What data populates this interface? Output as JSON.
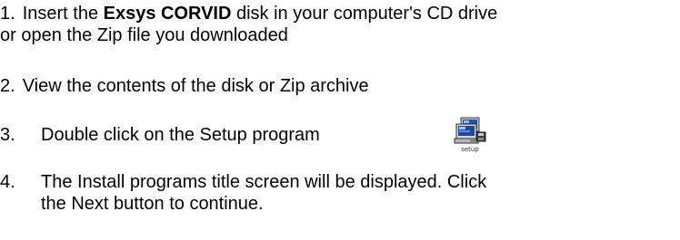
{
  "steps": [
    {
      "number": "1.",
      "before_bold": "Insert the ",
      "bold": "Exsys CORVID",
      "after_bold": " disk in your computer's CD drive",
      "line2": "or open the Zip file you downloaded"
    },
    {
      "number": "2.",
      "text": "View the contents of the disk or Zip archive"
    },
    {
      "number": "3.",
      "text": "Double click on the Setup program",
      "icon": "setup-program-icon",
      "icon_caption": "setup"
    },
    {
      "number": "4.",
      "line1": "The Install programs title screen will be displayed. Click",
      "line2": "the Next button to continue."
    }
  ]
}
